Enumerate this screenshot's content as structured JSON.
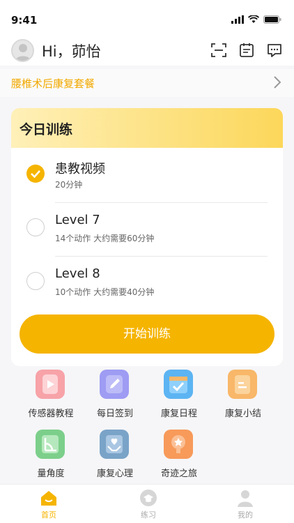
{
  "status": {
    "time": "9:41"
  },
  "header": {
    "greeting": "Hi，茆怡"
  },
  "package": {
    "name": "腰椎术后康复套餐"
  },
  "today": {
    "title": "今日训练",
    "tasks": [
      {
        "title": "患教视频",
        "subtitle": "20分钟",
        "done": true
      },
      {
        "title": "Level 7",
        "subtitle": "14个动作 大约需要60分钟",
        "done": false
      },
      {
        "title": "Level 8",
        "subtitle": "10个动作 大约需要40分钟",
        "done": false
      }
    ],
    "start_label": "开始训练"
  },
  "tools": [
    {
      "label": "传感器教程",
      "icon": "video-play-icon",
      "color": "#f7a3a8"
    },
    {
      "label": "每日签到",
      "icon": "pencil-icon",
      "color": "#9e9cf3"
    },
    {
      "label": "康复日程",
      "icon": "calendar-check-icon",
      "color": "#5cb4f2"
    },
    {
      "label": "康复小结",
      "icon": "clipboard-icon",
      "color": "#f8b769"
    },
    {
      "label": "量角度",
      "icon": "protractor-icon",
      "color": "#7ccf8a"
    },
    {
      "label": "康复心理",
      "icon": "heart-hands-icon",
      "color": "#7aa3c8"
    },
    {
      "label": "奇迹之旅",
      "icon": "trophy-icon",
      "color": "#f79a5a"
    }
  ],
  "tabbar": {
    "tabs": [
      {
        "label": "首页",
        "active": true
      },
      {
        "label": "练习",
        "active": false
      },
      {
        "label": "我的",
        "active": false
      }
    ]
  },
  "colors": {
    "accent": "#f5b400",
    "package_text": "#f2a900"
  }
}
